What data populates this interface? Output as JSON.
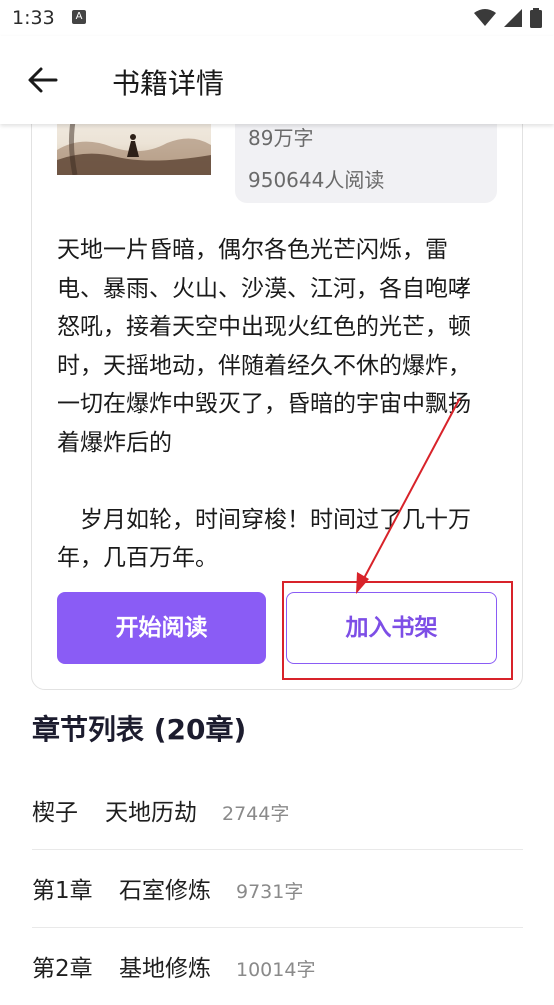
{
  "status_bar": {
    "time": "1:33",
    "notification_icon": "a-notification-icon",
    "wifi_icon": "wifi-icon",
    "signal_icon": "signal-icon",
    "battery_icon": "battery-icon"
  },
  "header": {
    "back_icon": "back-arrow-icon",
    "title": "书籍详情"
  },
  "book": {
    "cover_icon": "book-cover-image",
    "word_count": "89万字",
    "readers": "950644人阅读",
    "summary": "天地一片昏暗，偶尔各色光芒闪烁，雷电、暴雨、火山、沙漠、江河，各自咆哮怒吼，接着天空中出现火红色的光芒，顿时，天摇地动，伴随着经久不休的爆炸，一切在爆炸中毁灭了，昏暗的宇宙中飘扬着爆炸后的\n\n　岁月如轮，时间穿梭！时间过了几十万年，几百万年。"
  },
  "actions": {
    "start_reading": "开始阅读",
    "add_to_shelf": "加入书架"
  },
  "annotation": {
    "color": "#d8232a"
  },
  "chapters": {
    "heading": "章节列表 (20章)",
    "items": [
      {
        "num": "楔子",
        "title": "天地历劫",
        "words": "2744字"
      },
      {
        "num": "第1章",
        "title": "石室修炼",
        "words": "9731字"
      },
      {
        "num": "第2章",
        "title": "基地修炼",
        "words": "10014字"
      }
    ]
  },
  "colors": {
    "accent": "#8a5cf5",
    "info_box": "#f1f1f4"
  }
}
